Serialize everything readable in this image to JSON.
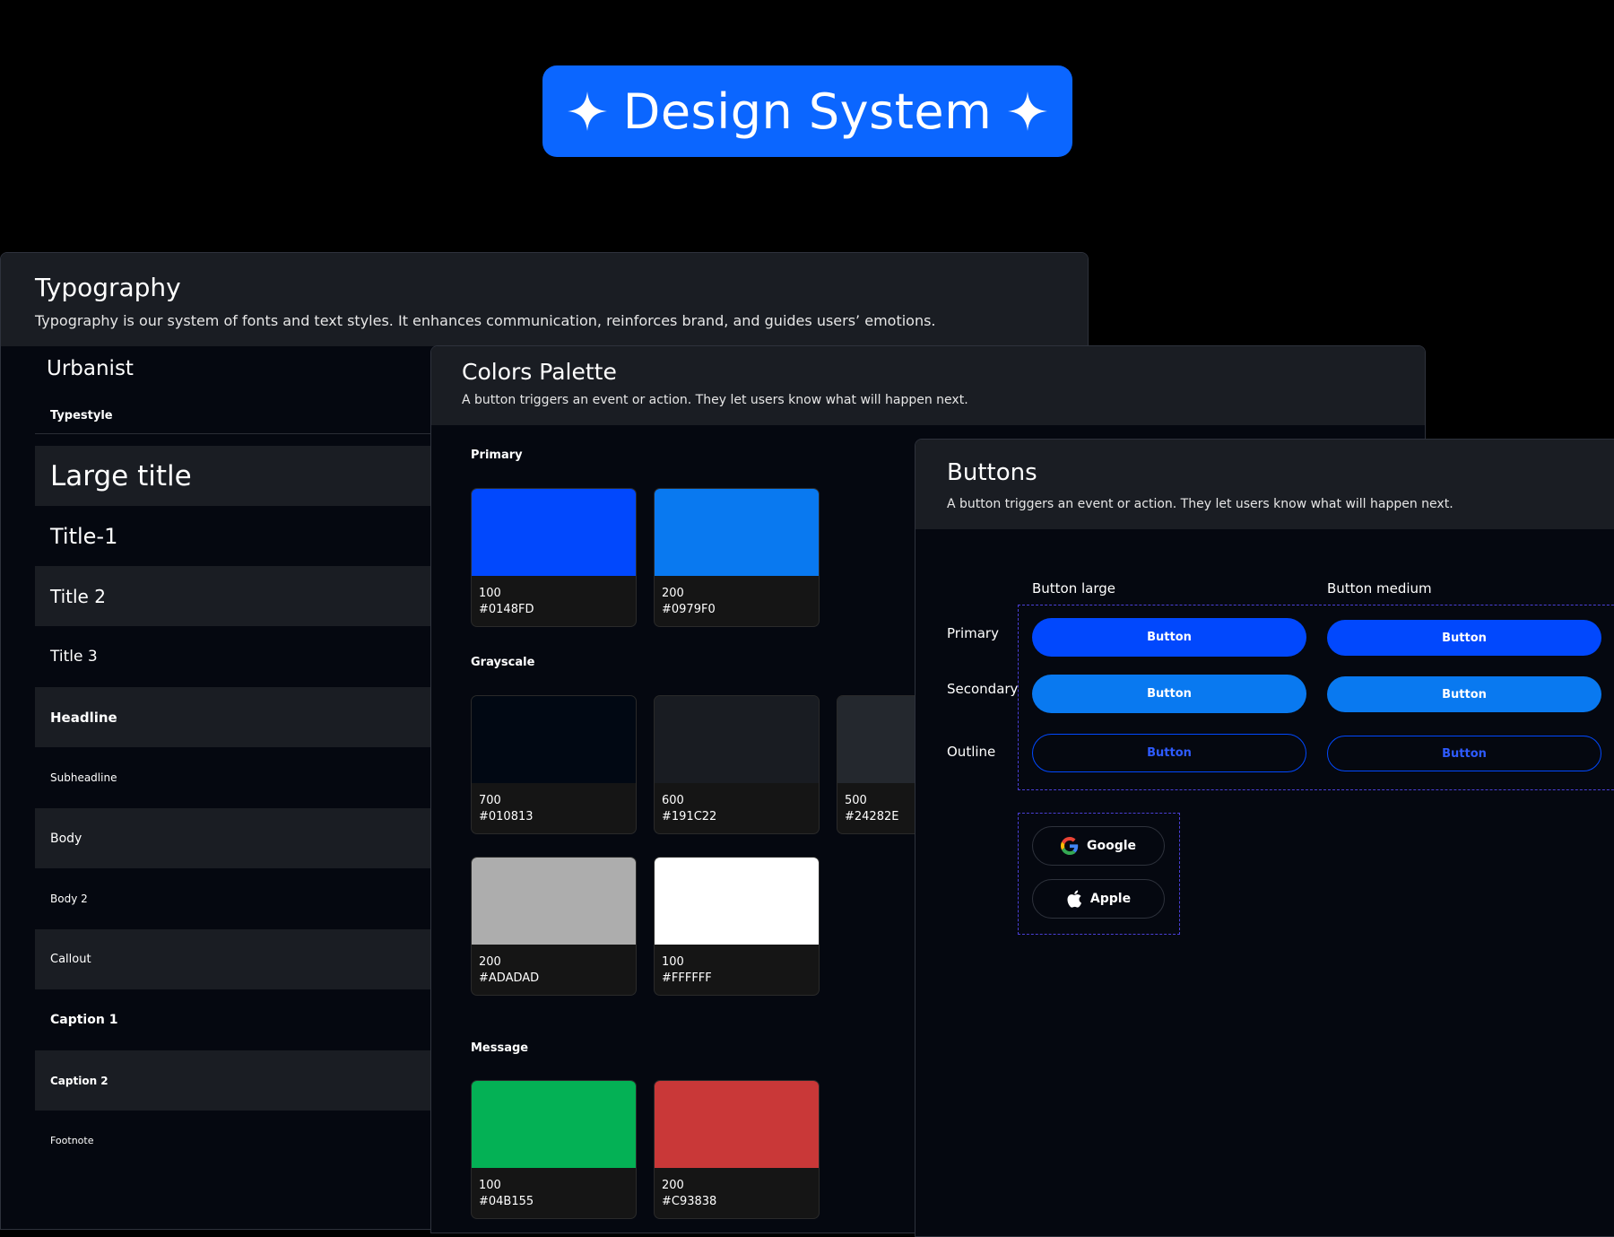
{
  "header": {
    "title": "Design System"
  },
  "typography": {
    "title": "Typography",
    "description": "Typography is our system of fonts and text styles. It enhances communication, reinforces brand, and guides users’ emotions.",
    "font_name": "Urbanist",
    "typestyle_label": "Typestyle",
    "styles": [
      "Large title",
      "Title-1",
      "Title 2",
      "Title 3",
      "Headline",
      "Subheadline",
      "Body",
      "Body 2",
      "Callout",
      "Caption 1",
      "Caption 2",
      "Footnote"
    ]
  },
  "colors": {
    "title": "Colors Palette",
    "description": "A button triggers an event or action. They let users know what will happen next.",
    "groups": {
      "primary": {
        "label": "Primary",
        "swatches": [
          {
            "shade": "100",
            "hex": "#0148FD"
          },
          {
            "shade": "200",
            "hex": "#0979F0"
          }
        ]
      },
      "grayscale": {
        "label": "Grayscale",
        "swatches": [
          {
            "shade": "700",
            "hex": "#010813"
          },
          {
            "shade": "600",
            "hex": "#191C22"
          },
          {
            "shade": "500",
            "hex": "#24282E"
          },
          {
            "shade": "200",
            "hex": "#ADADAD"
          },
          {
            "shade": "100",
            "hex": "#FFFFFF"
          }
        ]
      },
      "message": {
        "label": "Message",
        "swatches": [
          {
            "shade": "100",
            "hex": "#04B155"
          },
          {
            "shade": "200",
            "hex": "#C93838"
          }
        ]
      }
    }
  },
  "buttons": {
    "title": "Buttons",
    "description": "A button triggers an event or action. They let users know what will happen next.",
    "columns": {
      "large": "Button large",
      "medium": "Button medium"
    },
    "rows": {
      "primary": "Primary",
      "secondary": "Secondary",
      "outline": "Outline"
    },
    "button_label": "Button",
    "social": {
      "google": "Google",
      "apple": "Apple"
    }
  },
  "theme": {
    "background": "#000000",
    "card_header": "#1A1D23",
    "card_body": "#050810",
    "accent": "#0B66FF",
    "dashed_border": "#4A3FD6"
  }
}
